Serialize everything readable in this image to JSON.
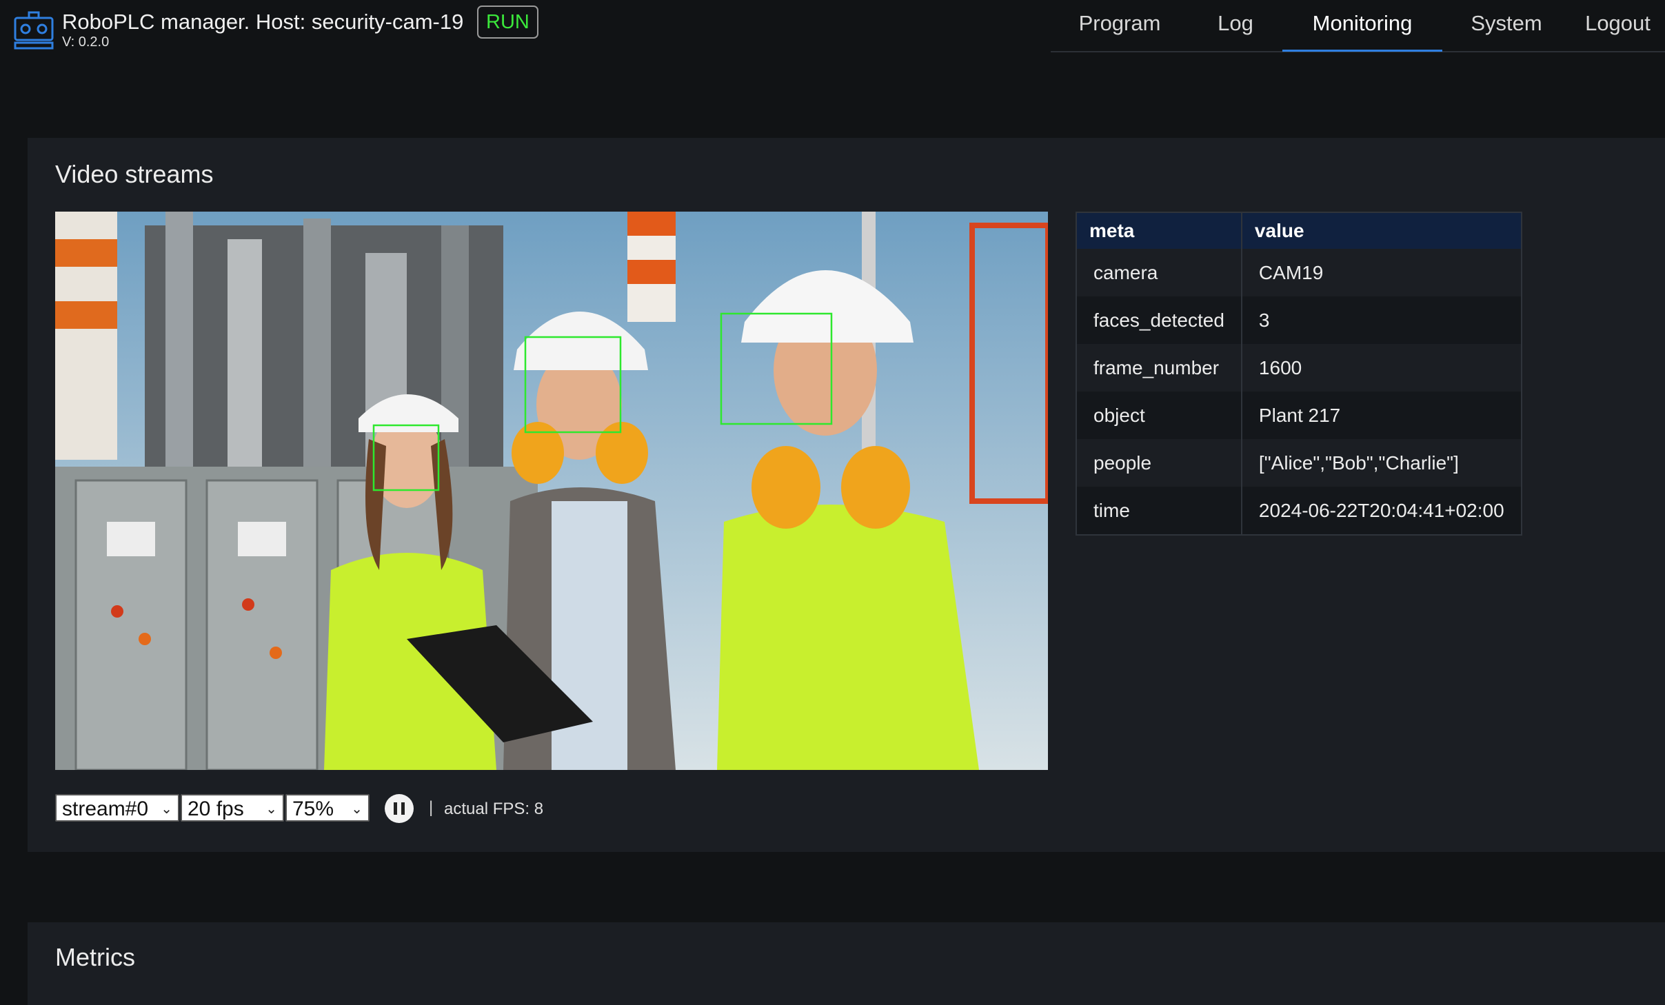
{
  "header": {
    "app_title": "RoboPLC manager. Host: security-cam-19",
    "status": "RUN",
    "version": "V: 0.2.0",
    "status_color": "#3be83b",
    "logo_icon": "robot-logo-icon"
  },
  "nav": {
    "items": [
      {
        "label": "Program"
      },
      {
        "label": "Log"
      },
      {
        "label": "Monitoring",
        "active": true
      },
      {
        "label": "System"
      },
      {
        "label": "Logout"
      }
    ],
    "active_color": "#2f7fe0"
  },
  "video_panel": {
    "title": "Video streams",
    "detections": 3
  },
  "meta_table": {
    "headers": [
      "meta",
      "value"
    ],
    "rows": [
      {
        "key": "camera",
        "value": "CAM19"
      },
      {
        "key": "faces_detected",
        "value": "3"
      },
      {
        "key": "frame_number",
        "value": "1600"
      },
      {
        "key": "object",
        "value": "Plant 217"
      },
      {
        "key": "people",
        "value": "[\"Alice\",\"Bob\",\"Charlie\"]"
      },
      {
        "key": "time",
        "value": "2024-06-22T20:04:41+02:00"
      }
    ]
  },
  "controls": {
    "stream_select": "stream#0",
    "fps_select": "20 fps",
    "scale_select": "75%",
    "pause_icon": "pause-icon",
    "separator": "|",
    "actual_fps": "actual FPS: 8"
  },
  "metrics_panel": {
    "title": "Metrics"
  }
}
